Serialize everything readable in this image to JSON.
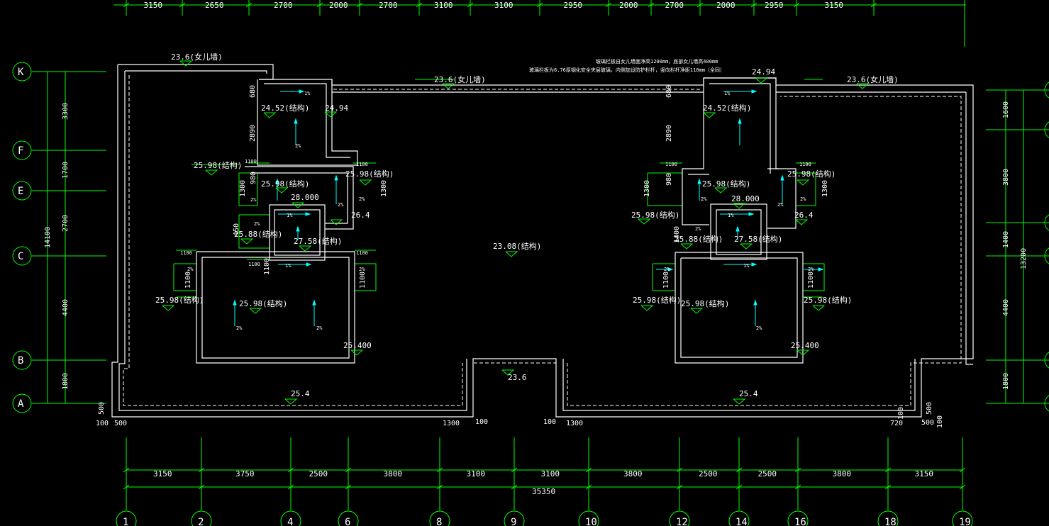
{
  "palette": {
    "background": "#000000",
    "grid": "#00ff00",
    "wall": "#ffffff",
    "arrow": "#00ffff",
    "text": "#ffffff"
  },
  "top_dims": [
    "3150",
    "2650",
    "2700",
    "2000",
    "2700",
    "3100",
    "3100",
    "2950",
    "2000",
    "2700",
    "2000",
    "2950",
    "3150"
  ],
  "bottom_dims": [
    "3150",
    "3750",
    "2500",
    "3800",
    "3100",
    "3100",
    "3800",
    "2500",
    "2500",
    "3800",
    "3150"
  ],
  "bottom_total": "35350",
  "bottom_axes": [
    "1",
    "2",
    "4",
    "6",
    "8",
    "9",
    "10",
    "12",
    "14",
    "16",
    "18",
    "19"
  ],
  "left_axes": [
    "K",
    "F",
    "E",
    "C",
    "B",
    "A"
  ],
  "left_dims": [
    "3300",
    "1700",
    "2700",
    "4400",
    "1800"
  ],
  "left_total": "14100",
  "right_dims": [
    "1600",
    "3800",
    "1400",
    "4400",
    "1800"
  ],
  "right_total": "13200",
  "notes": {
    "line1": "玻璃栏板自女儿墙面净高1200mm，底部女儿墙高400mm",
    "line2": "玻璃栏板为6.76厚钢化安全夹层玻璃，内侧加设防护栏杆，竖向栏杆净距110mm（全同）"
  },
  "levels": {
    "parapet_left": "23.6(女儿墙)",
    "parapet_mid": "23.6(女儿墙)",
    "parapet_right": "23.6(女儿墙)",
    "roof_main": "23.08(结构)",
    "notch": "23.6",
    "bottom_left": "25.4",
    "bottom_right": "25.4",
    "l_stair_top": "24.52(结构)",
    "l_stair_side": "24.94",
    "l_mid_left": "25.98(结构)",
    "l_mid_inner": "25.98(结构)",
    "l_mid_right": "25.98(结构)",
    "l_box_top": "28.000",
    "l_box_right": "26.4",
    "l_box_inner": "27.58(结构)",
    "l_small_left": "25.88(结构)",
    "l_big_left": "25.98(结构)",
    "l_big_inner": "25.98(结构)",
    "l_big_corner": "25.400",
    "r_stair_top": "24.52(结构)",
    "r_stair_side": "24.94",
    "r_mid_left": "25.98(结构)",
    "r_mid_inner": "25.98(结构)",
    "r_mid_right": "25.98(结构)",
    "r_box_top": "28.000",
    "r_box_right": "26.4",
    "r_box_inner": "27.58(结构)",
    "r_small_left": "25.88(结构)",
    "r_big_left": "25.98(结构)",
    "r_big_inner": "25.98(结构)",
    "r_big_right": "25.98(结构)",
    "r_big_corner": "25.400"
  },
  "small_dims": {
    "d680": "680",
    "d2890": "2890",
    "d1100": "1100",
    "d980": "980",
    "d1300": "1300",
    "d500": "500",
    "d100": "100",
    "d720": "720",
    "d450": "450",
    "d1400": "1400"
  },
  "slopes": {
    "one": "1%",
    "two": "2%"
  }
}
